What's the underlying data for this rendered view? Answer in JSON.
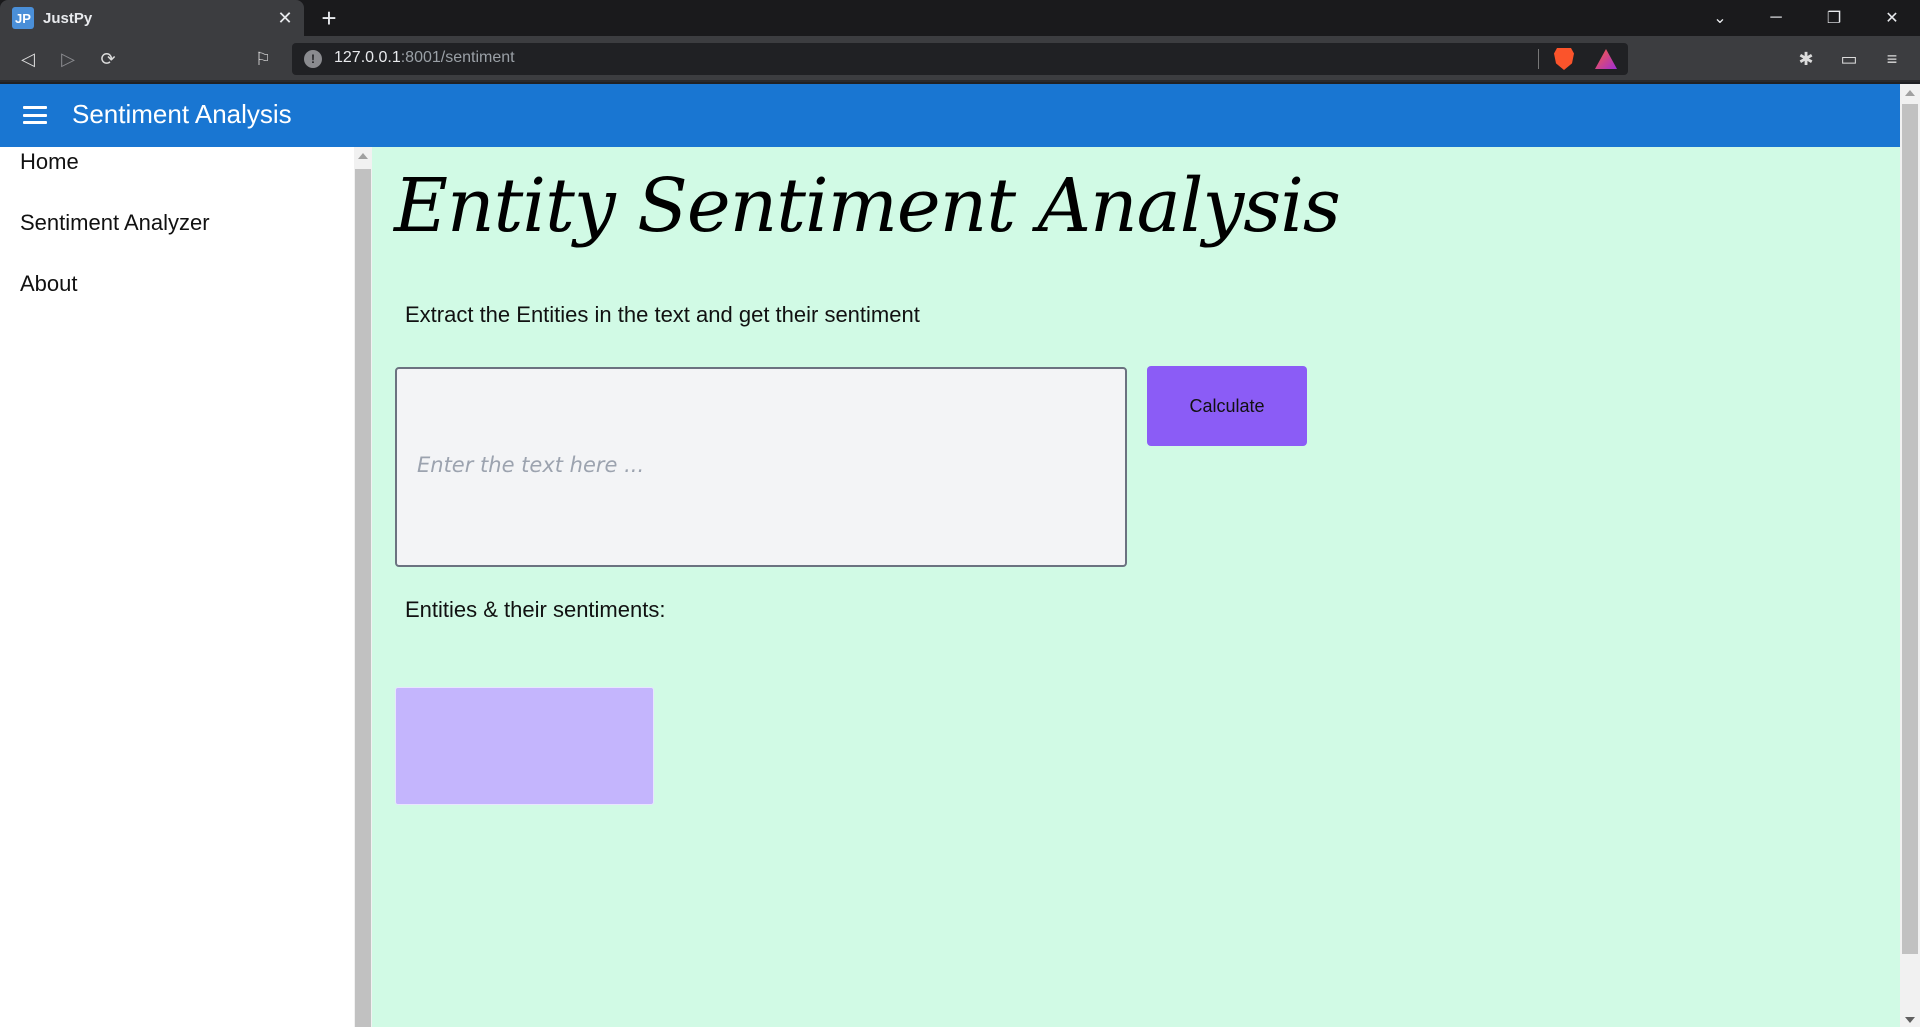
{
  "browser": {
    "tab": {
      "favicon_text": "JP",
      "title": "JustPy"
    },
    "url": {
      "host": "127.0.0.1",
      "rest": ":8001/sentiment"
    }
  },
  "app": {
    "title": "Sentiment Analysis",
    "accent_color": "#1976d2"
  },
  "drawer": {
    "items": [
      {
        "label": "Home"
      },
      {
        "label": "Sentiment Analyzer"
      },
      {
        "label": "About"
      }
    ]
  },
  "main": {
    "heading": "Entity Sentiment Analysis",
    "subtitle": "Extract the Entities in the text and get their sentiment",
    "input": {
      "placeholder": "Enter the text here ...",
      "value": ""
    },
    "calculate_label": "Calculate",
    "results_label": "Entities & their sentiments:",
    "background_color": "#d1fae5",
    "button_color": "#8b5cf6",
    "results_box_color": "#c4b5fd"
  }
}
